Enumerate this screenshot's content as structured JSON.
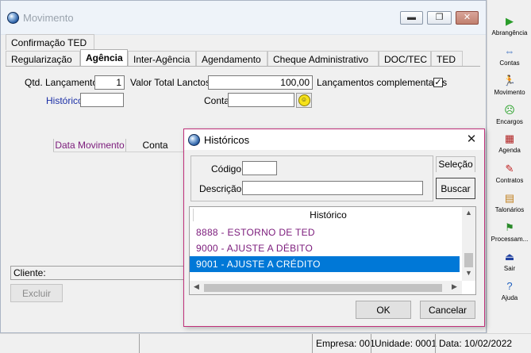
{
  "main_window": {
    "title": "Movimento",
    "tabs_row1": [
      "Confirmação TED"
    ],
    "tabs_row2": [
      "Regularização",
      "Agência",
      "Inter-Agência",
      "Agendamento",
      "Cheque Administrativo",
      "DOC/TEC",
      "TED"
    ],
    "active_tab": "Agência",
    "form": {
      "qtd_label": "Qtd. Lançamentos",
      "qtd_value": "1",
      "valor_label": "Valor Total Lanctos.",
      "valor_value": "100,00",
      "complementares_label": "Lançamentos complementares",
      "complementares_checked": true,
      "historico_label": "Histórico",
      "historico_value": "",
      "conta_label": "Conta",
      "conta_value": ""
    },
    "grid_headers": [
      "Data Movimento",
      "Conta"
    ],
    "cliente_label": "Cliente:",
    "excluir_label": "Excluir"
  },
  "toolbar": {
    "items": [
      {
        "label": "Abrangência",
        "icon": "abrangencia-icon",
        "glyph": "▶",
        "color": "#2a9d2a"
      },
      {
        "label": "Contas",
        "icon": "contas-icon",
        "glyph": "⇔",
        "color": "#3b6fc0"
      },
      {
        "label": "Movimento",
        "icon": "movimento-icon",
        "glyph": "🏃",
        "color": "#222222"
      },
      {
        "label": "Encargos",
        "icon": "encargos-icon",
        "glyph": "☹",
        "color": "#1e9e1e"
      },
      {
        "label": "Agenda",
        "icon": "agenda-icon",
        "glyph": "▦",
        "color": "#b02020"
      },
      {
        "label": "Contratos",
        "icon": "contratos-icon",
        "glyph": "✎",
        "color": "#c02020"
      },
      {
        "label": "Talonários",
        "icon": "talonarios-icon",
        "glyph": "▤",
        "color": "#c08020"
      },
      {
        "label": "Processam...",
        "icon": "processamento-icon",
        "glyph": "⚑",
        "color": "#2a8a2a"
      },
      {
        "label": "Sair",
        "icon": "sair-icon",
        "glyph": "⏏",
        "color": "#2040a0"
      },
      {
        "label": "Ajuda",
        "icon": "ajuda-icon",
        "glyph": "?",
        "color": "#2060c0"
      }
    ]
  },
  "dialog": {
    "title": "Históricos",
    "codigo_label": "Código:",
    "codigo_value": "",
    "descricao_label": "Descrição:",
    "descricao_value": "",
    "selecao_label": "Seleção",
    "buscar_label": "Buscar",
    "list_header": "Histórico",
    "rows": [
      {
        "text": "8888  - ESTORNO DE TED",
        "selected": false
      },
      {
        "text": "9000  - AJUSTE A DÉBITO",
        "selected": false
      },
      {
        "text": "9001  - AJUSTE A CRÉDITO",
        "selected": true
      }
    ],
    "ok_label": "OK",
    "cancel_label": "Cancelar"
  },
  "statusbar": {
    "empresa": "Empresa: 001",
    "unidade": "Unidade: 0001",
    "data": "Data:  10/02/2022"
  }
}
